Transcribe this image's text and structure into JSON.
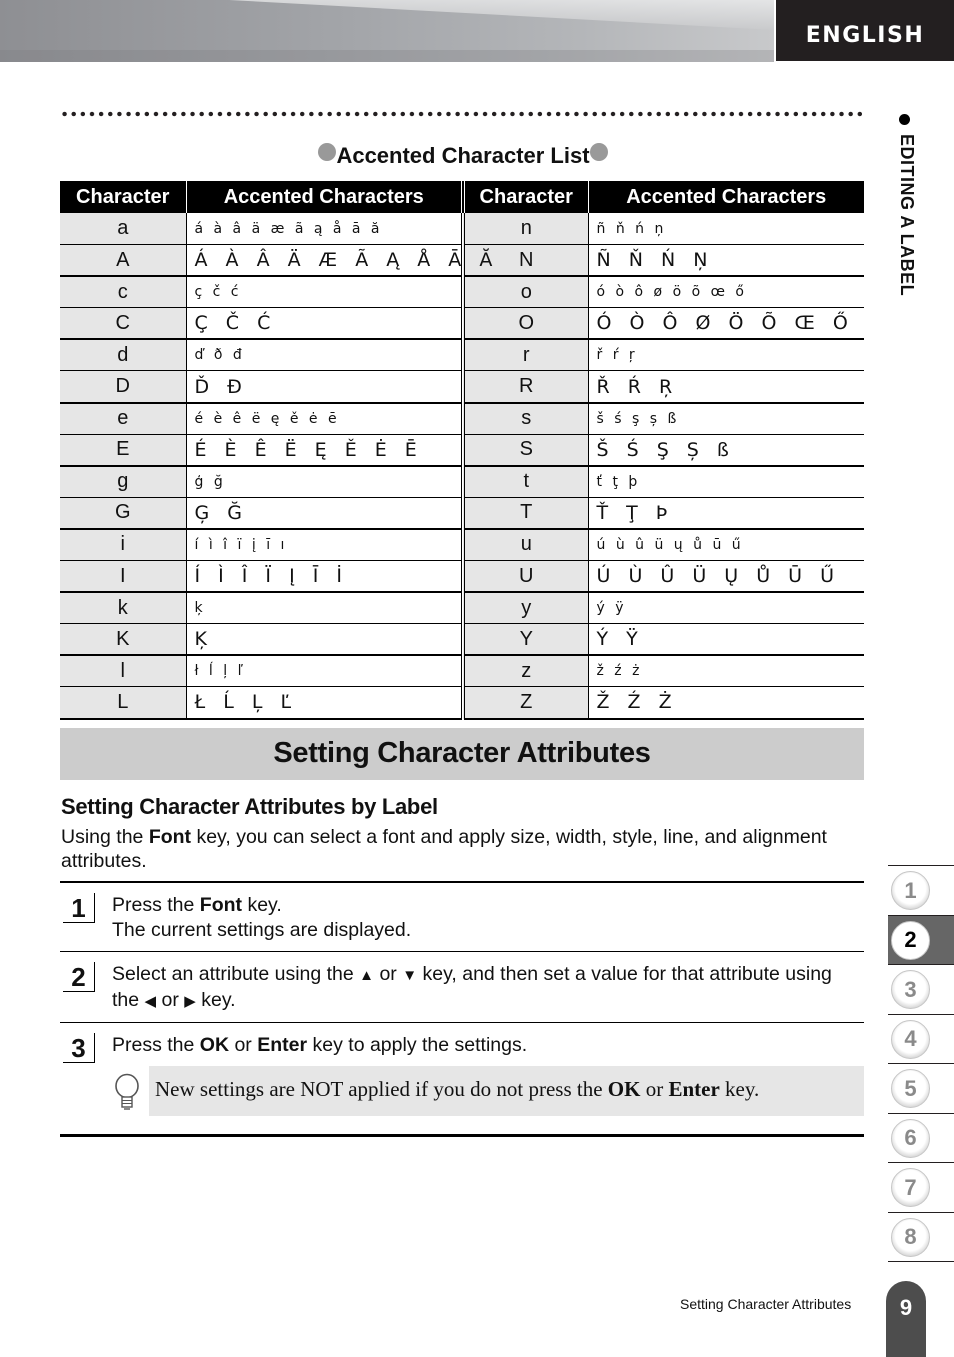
{
  "header": {
    "language": "ENGLISH"
  },
  "side_section": {
    "label": "EDITING A LABEL"
  },
  "accented_table": {
    "title": "Accented Character List",
    "headers": [
      "Character",
      "Accented Characters",
      "Character",
      "Accented Characters"
    ],
    "left": [
      {
        "char": "a",
        "accents": "á à â ä æ ã ą å ā ă"
      },
      {
        "char": "A",
        "accents": "Á À Â Ä Æ Ã Ą Å Ā Ă"
      },
      {
        "char": "c",
        "accents": "ç č ć"
      },
      {
        "char": "C",
        "accents": "Ç Č Ć"
      },
      {
        "char": "d",
        "accents": "ď ð đ"
      },
      {
        "char": "D",
        "accents": "Ď Đ"
      },
      {
        "char": "e",
        "accents": "é è ê ë ę ě ė ē"
      },
      {
        "char": "E",
        "accents": "É È Ê Ë Ę Ě Ė Ē"
      },
      {
        "char": "g",
        "accents": "ģ ğ"
      },
      {
        "char": "G",
        "accents": "Ģ Ğ"
      },
      {
        "char": "i",
        "accents": "í ì î ï į ī ı"
      },
      {
        "char": "I",
        "accents": "Í Ì Î Ï Į Ī İ"
      },
      {
        "char": "k",
        "accents": "ķ"
      },
      {
        "char": "K",
        "accents": "Ķ"
      },
      {
        "char": "l",
        "accents": "ł ĺ ļ ľ"
      },
      {
        "char": "L",
        "accents": "Ł Ĺ Ļ Ľ"
      }
    ],
    "right": [
      {
        "char": "n",
        "accents": "ñ ň ń ņ"
      },
      {
        "char": "N",
        "accents": "Ñ Ň Ń Ņ"
      },
      {
        "char": "o",
        "accents": "ó ò ô ø ö õ œ ő"
      },
      {
        "char": "O",
        "accents": "Ó Ò Ô Ø Ö Õ Œ Ő"
      },
      {
        "char": "r",
        "accents": "ř ŕ ŗ"
      },
      {
        "char": "R",
        "accents": "Ř Ŕ Ŗ"
      },
      {
        "char": "s",
        "accents": "š ś ş ș ß"
      },
      {
        "char": "S",
        "accents": "Š Ś Ş Ș ß"
      },
      {
        "char": "t",
        "accents": "ť ţ þ"
      },
      {
        "char": "T",
        "accents": "Ť Ţ Þ"
      },
      {
        "char": "u",
        "accents": "ú ù û ü ų ů ū ű"
      },
      {
        "char": "U",
        "accents": "Ú Ù Û Ü Ų Ů Ū Ű"
      },
      {
        "char": "y",
        "accents": "ý ÿ"
      },
      {
        "char": "Y",
        "accents": "Ý Ÿ"
      },
      {
        "char": "z",
        "accents": "ž ź ż"
      },
      {
        "char": "Z",
        "accents": "Ž Ź Ż"
      }
    ]
  },
  "section": {
    "title": "Setting Character Attributes",
    "subheading": "Setting Character Attributes by Label",
    "intro_pre": "Using the ",
    "intro_key": "Font",
    "intro_post": " key, you can select a font and apply size, width, style, line, and alignment attributes."
  },
  "steps": [
    {
      "number": "1",
      "line1_pre": "Press the ",
      "line1_key": "Font",
      "line1_post": " key.",
      "line2": "The current settings are displayed."
    },
    {
      "number": "2",
      "pre": "Select an attribute using the ",
      "up_icon": "▲",
      "or1": " or ",
      "down_icon": "▼",
      "mid": " key, and then set a value for that attribute using the ",
      "left_icon": "◀",
      "or2": " or ",
      "right_icon": "▶",
      "post": " key."
    },
    {
      "number": "3",
      "pre": "Press the ",
      "key1": "OK",
      "or": " or ",
      "key2": "Enter",
      "post": " key to apply the settings."
    }
  ],
  "hint": {
    "icon": "lightbulb-icon",
    "pre": "New settings are NOT applied if you do not press the ",
    "key1": "OK",
    "or": " or ",
    "key2": "Enter",
    "post": " key."
  },
  "chapter_tabs": {
    "items": [
      "1",
      "2",
      "3",
      "4",
      "5",
      "6",
      "7",
      "8"
    ],
    "active": "2"
  },
  "footer": {
    "running_title": "Setting Character Attributes",
    "page_number": "9"
  }
}
